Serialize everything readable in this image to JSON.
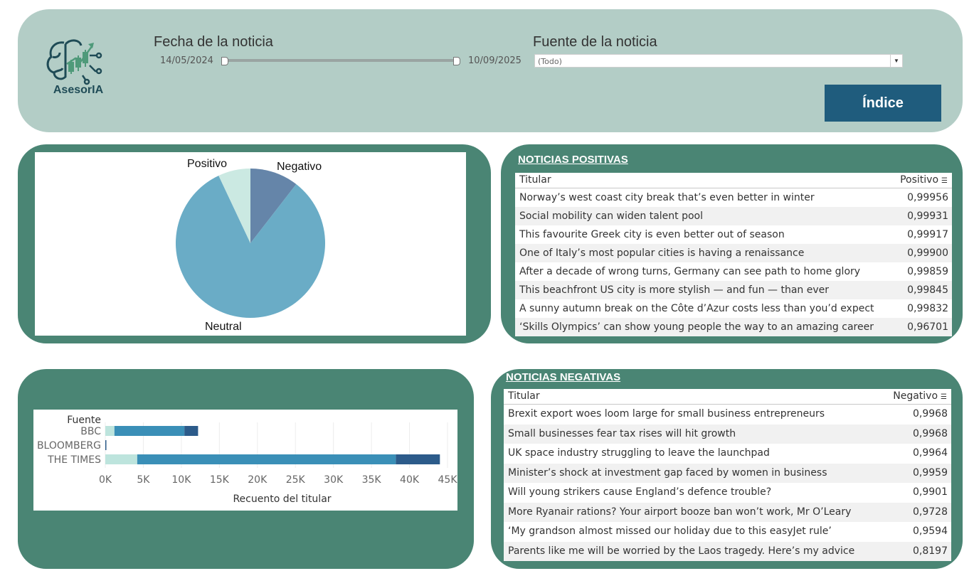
{
  "header": {
    "logo_text": "AsesorIA",
    "date_filter": {
      "label": "Fecha de la noticia",
      "start": "14/05/2024",
      "end": "10/09/2025"
    },
    "source_filter": {
      "label": "Fuente de la noticia",
      "value": "(Todo)"
    },
    "index_button": "Índice"
  },
  "pie": {
    "labels": {
      "positive": "Positivo",
      "negative": "Negativo",
      "neutral": "Neutral"
    }
  },
  "chart_data": [
    {
      "type": "pie",
      "slices": [
        {
          "label": "Negativo",
          "value": 10.5,
          "color": "#6585a9"
        },
        {
          "label": "Neutral",
          "value": 82.5,
          "color": "#6aacc6"
        },
        {
          "label": "Positivo",
          "value": 7.0,
          "color": "#cbe9e2"
        }
      ]
    },
    {
      "type": "bar",
      "stacked": true,
      "orientation": "horizontal",
      "categories": [
        "BBC",
        "BLOOMBERG",
        "THE TIMES"
      ],
      "series": [
        {
          "name": "Positivo",
          "values": [
            1200,
            0,
            4200
          ],
          "color": "#bde4dd"
        },
        {
          "name": "Neutral",
          "values": [
            9200,
            0,
            34000
          ],
          "color": "#3a8fb7"
        },
        {
          "name": "Negativo",
          "values": [
            1800,
            100,
            5800
          ],
          "color": "#2c5b8a"
        }
      ],
      "xlabel": "Recuento del titular",
      "ylabel": "Fuente",
      "xlim": [
        0,
        45000
      ],
      "ticks": [
        "0K",
        "5K",
        "10K",
        "15K",
        "20K",
        "25K",
        "30K",
        "35K",
        "40K",
        "45K"
      ],
      "grid": true
    }
  ],
  "positive_news": {
    "title": "NOTICIAS POSITIVAS",
    "columns": [
      "Titular",
      "Positivo"
    ],
    "rows": [
      [
        "Norway’s west coast city break that’s even better in winter",
        "0,99956"
      ],
      [
        "Social mobility can widen talent pool",
        "0,99931"
      ],
      [
        "This favourite Greek city is even better out of season",
        "0,99917"
      ],
      [
        "One of Italy’s most popular cities is having a renaissance",
        "0,99900"
      ],
      [
        "After a decade of wrong turns, Germany can see path to home glory",
        "0,99859"
      ],
      [
        "This beachfront US city is more stylish — and fun — than ever",
        "0,99845"
      ],
      [
        "A sunny autumn break on the Côte d’Azur costs less than you’d expect",
        "0,99832"
      ],
      [
        "‘Skills Olympics’ can show young people the way to an amazing career",
        "0,96701"
      ]
    ]
  },
  "negative_news": {
    "title": "NOTICIAS NEGATIVAS",
    "columns": [
      "Titular",
      "Negativo"
    ],
    "rows": [
      [
        "Brexit export woes loom large for small business entrepreneurs",
        "0,9968"
      ],
      [
        "Small businesses fear tax rises will hit growth",
        "0,9968"
      ],
      [
        "UK space industry struggling to leave the launchpad",
        "0,9964"
      ],
      [
        "Minister’s shock at investment gap faced by women in business",
        "0,9959"
      ],
      [
        "Will young strikers cause England’s defence trouble?",
        "0,9901"
      ],
      [
        "More Ryanair rations? Your airport booze ban won’t work, Mr O’Leary",
        "0,9728"
      ],
      [
        "‘My grandson almost missed our holiday due to this easyJet rule’",
        "0,9594"
      ],
      [
        "Parents like me will be worried by the Laos tragedy. Here’s my advice",
        "0,8197"
      ]
    ]
  }
}
